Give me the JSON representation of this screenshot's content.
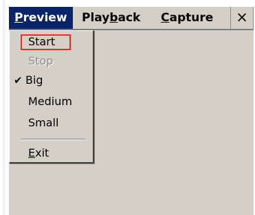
{
  "menubar": {
    "items": [
      {
        "label_pre": "",
        "mnemonic": "P",
        "label_post": "review"
      },
      {
        "label_pre": "Play",
        "mnemonic": "b",
        "label_post": "ack"
      },
      {
        "label_pre": "",
        "mnemonic": "C",
        "label_post": "apture"
      }
    ],
    "close_label": "×"
  },
  "dropdown": {
    "items": [
      {
        "label": "Start"
      },
      {
        "label": "Stop"
      },
      {
        "label": "Big",
        "check": "✔"
      },
      {
        "label": "Medium"
      },
      {
        "label": "Small"
      },
      {
        "mnemonic": "E",
        "label_post": "xit"
      }
    ]
  }
}
